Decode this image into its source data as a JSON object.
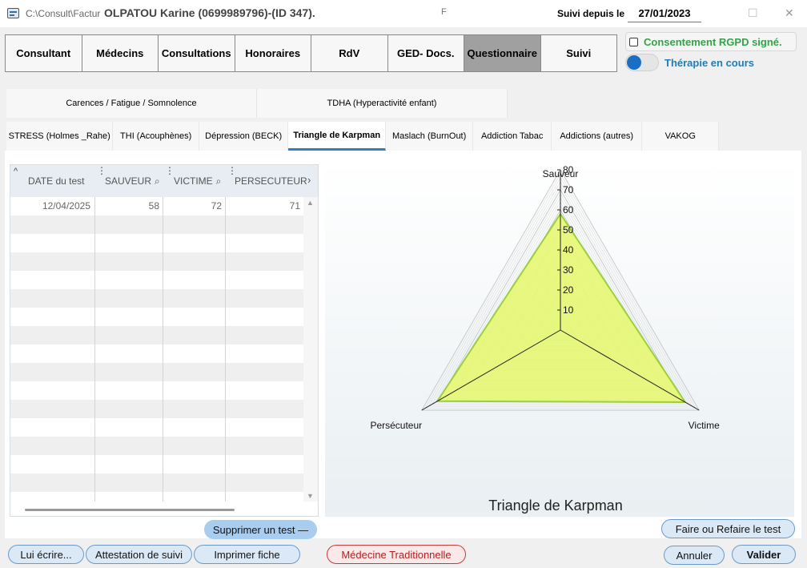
{
  "window": {
    "path": "C:\\Consult\\Factur",
    "patient": "OLPATOU Karine (0699989796)-(ID 347).",
    "marker": "F",
    "suivi_label": "Suivi depuis le",
    "suivi_date": "27/01/2023"
  },
  "main_tabs": [
    "Consultant",
    "Médecins",
    "Consultations",
    "Honoraires",
    "RdV",
    "GED- Docs.",
    "Questionnaire",
    "Suivi"
  ],
  "rgpd_label": "Consentement RGPD signé.",
  "therapie_label": "Thérapie en cours",
  "category_tabs": [
    "Carences / Fatigue / Somnolence",
    "TDHA (Hyperactivité enfant)"
  ],
  "sub_tabs": [
    "STRESS (Holmes _Rahe)",
    "THI (Acouphènes)",
    "Dépression (BECK)",
    "Triangle de Karpman",
    "Maslach (BurnOut)",
    "Addiction Tabac",
    "Addictions (autres)",
    "VAKOG"
  ],
  "table": {
    "columns": [
      "DATE du test",
      "SAUVEUR",
      "VICTIME",
      "PERSECUTEUR"
    ],
    "rows": [
      [
        "12/04/2025",
        "58",
        "72",
        "71"
      ]
    ]
  },
  "chart_data": {
    "type": "radar",
    "title": "Triangle de Karpman",
    "axes": [
      "Sauveur",
      "Victime",
      "Persécuteur"
    ],
    "values": [
      58,
      72,
      71
    ],
    "ticks": [
      10,
      20,
      30,
      40,
      50,
      60,
      70,
      80
    ],
    "range": [
      0,
      80
    ],
    "fill_color": "#e6f772",
    "stroke_color": "#9bcf3c"
  },
  "buttons": {
    "supprimer": "Supprimer un test —",
    "faire": "Faire ou Refaire le test",
    "lui_ecrire": "Lui écrire...",
    "attestation": "Attestation de suivi",
    "imprimer": "Imprimer fiche",
    "medecine": "Médecine Traditionnelle",
    "annuler": "Annuler",
    "valider": "Valider"
  }
}
